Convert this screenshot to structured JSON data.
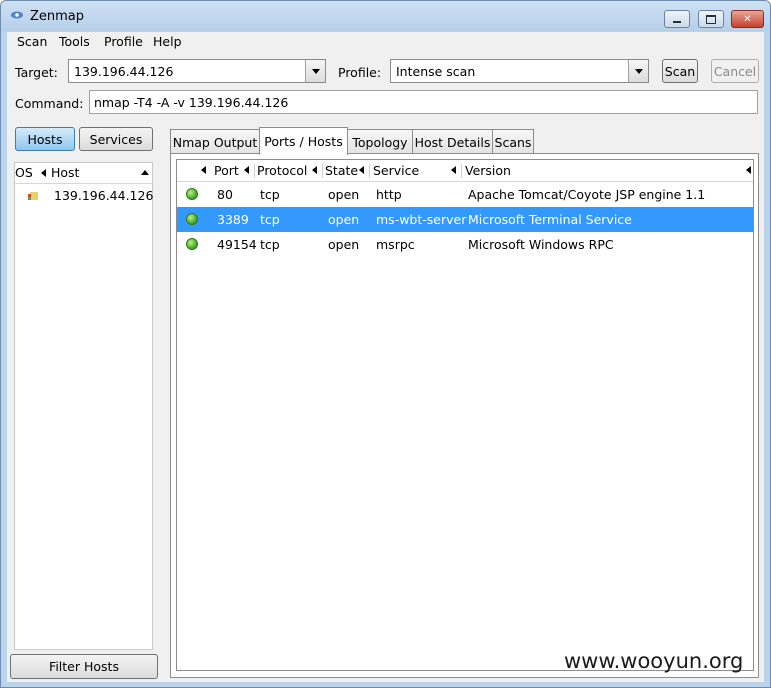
{
  "window": {
    "title": "Zenmap"
  },
  "menu": [
    "Scan",
    "Tools",
    "Profile",
    "Help"
  ],
  "toolbar": {
    "target_label": "Target:",
    "target_value": "139.196.44.126",
    "profile_label": "Profile:",
    "profile_value": "Intense scan",
    "scan_button": "Scan",
    "cancel_button": "Cancel",
    "command_label": "Command:",
    "command_value": "nmap -T4 -A -v 139.196.44.126"
  },
  "left": {
    "hosts_button": "Hosts",
    "services_button": "Services",
    "columns": {
      "os": "OS",
      "host": "Host"
    },
    "hosts": [
      {
        "host": "139.196.44.126"
      }
    ],
    "filter_button": "Filter Hosts"
  },
  "tabs": [
    "Nmap Output",
    "Ports / Hosts",
    "Topology",
    "Host Details",
    "Scans"
  ],
  "active_tab": "Ports / Hosts",
  "ports": {
    "columns": {
      "port": "Port",
      "protocol": "Protocol",
      "state": "State",
      "service": "Service",
      "version": "Version"
    },
    "rows": [
      {
        "port": "80",
        "protocol": "tcp",
        "state": "open",
        "service": "http",
        "version": "Apache Tomcat/Coyote JSP engine 1.1",
        "selected": false
      },
      {
        "port": "3389",
        "protocol": "tcp",
        "state": "open",
        "service": "ms-wbt-server",
        "version": "Microsoft Terminal Service",
        "selected": true
      },
      {
        "port": "49154",
        "protocol": "tcp",
        "state": "open",
        "service": "msrpc",
        "version": "Microsoft Windows RPC",
        "selected": false
      }
    ]
  },
  "watermark": "www.wooyun.org",
  "colors": {
    "selection": "#3399ff",
    "status_open": "#3da21e",
    "hosts_button_active": "#8fc6ee"
  }
}
